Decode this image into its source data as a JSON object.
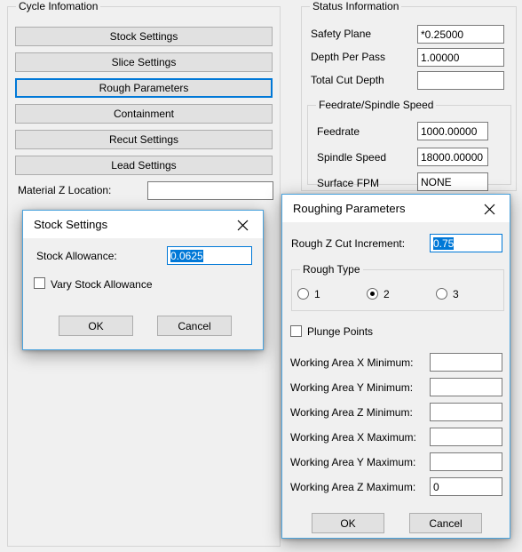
{
  "cycle_panel": {
    "title": "Cycle Infomation",
    "buttons": [
      {
        "label": "Stock Settings",
        "focused": false
      },
      {
        "label": "Slice Settings",
        "focused": false
      },
      {
        "label": "Rough Parameters",
        "focused": true
      },
      {
        "label": "Containment",
        "focused": false
      },
      {
        "label": "Recut Settings",
        "focused": false
      },
      {
        "label": "Lead Settings",
        "focused": false
      }
    ],
    "material_z_label": "Material Z Location:",
    "material_z_value": ""
  },
  "status_panel": {
    "title": "Status Information",
    "fields": [
      {
        "label": "Safety Plane",
        "value": "*0.25000"
      },
      {
        "label": "Depth Per Pass",
        "value": "1.00000"
      },
      {
        "label": "Total Cut Depth",
        "value": ""
      }
    ],
    "feed_group": {
      "title": "Feedrate/Spindle Speed",
      "fields": [
        {
          "label": "Feedrate",
          "value": "1000.00000"
        },
        {
          "label": "Spindle Speed",
          "value": "18000.00000"
        },
        {
          "label": "Surface FPM",
          "value": "NONE"
        }
      ]
    }
  },
  "stock_dialog": {
    "title": "Stock Settings",
    "close_icon": "close-icon",
    "allowance_label": "Stock Allowance:",
    "allowance_value": "0.0625",
    "vary_checkbox_label": "Vary Stock Allowance",
    "vary_checked": false,
    "ok_label": "OK",
    "cancel_label": "Cancel"
  },
  "roughing_dialog": {
    "title": "Roughing Parameters",
    "close_icon": "close-icon",
    "z_increment_label": "Rough Z Cut Increment:",
    "z_increment_value": "0.75",
    "rough_type": {
      "title": "Rough Type",
      "options": [
        {
          "label": "1",
          "checked": false
        },
        {
          "label": "2",
          "checked": true
        },
        {
          "label": "3",
          "checked": false
        }
      ]
    },
    "plunge_points_label": "Plunge Points",
    "plunge_points_checked": false,
    "working_area": [
      {
        "label": "Working Area X Minimum:",
        "value": ""
      },
      {
        "label": "Working Area Y Minimum:",
        "value": ""
      },
      {
        "label": "Working Area Z Minimum:",
        "value": ""
      },
      {
        "label": "Working Area X Maximum:",
        "value": ""
      },
      {
        "label": "Working Area Y Maximum:",
        "value": ""
      },
      {
        "label": "Working Area Z Maximum:",
        "value": "0"
      }
    ],
    "ok_label": "OK",
    "cancel_label": "Cancel"
  },
  "colors": {
    "accent": "#0078d7",
    "dialog_border": "#4ba3dd",
    "window_bg": "#f0f0f0",
    "button_bg": "#e1e1e1"
  }
}
